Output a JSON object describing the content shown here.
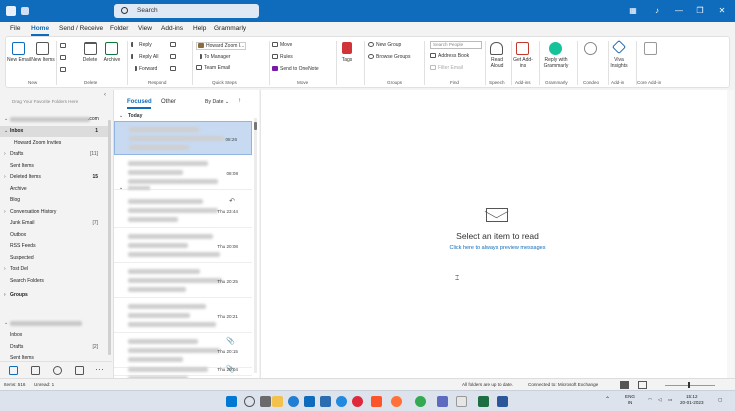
{
  "titlebar": {
    "search_placeholder": "Search"
  },
  "menu": {
    "tabs": [
      "File",
      "Home",
      "Send / Receive",
      "Folder",
      "View",
      "Add-ins",
      "Help",
      "Grammarly"
    ],
    "active": "Home"
  },
  "ribbon": {
    "new_email": "New Email",
    "new_items": "New Items",
    "delete": "Delete",
    "archive": "Archive",
    "reply": "Reply",
    "reply_all": "Reply All",
    "forward": "Forward",
    "quick_step_1": "Howard Zoom I...",
    "quick_step_2": "To Manager",
    "quick_step_3": "Team Email",
    "move": "Move",
    "rules": "Rules",
    "send_onenote": "Send to OneNote",
    "tags": "Tags",
    "new_group": "New Group",
    "browse_groups": "Browse Groups",
    "search_people": "Search People",
    "address_book": "Address Book",
    "filter_email": "Filter Email",
    "read_aloud": "Read Aloud",
    "get_addins": "Get Add-ins",
    "grammarly": "Reply with Grammarly",
    "viva_insights": "Viva Insights",
    "groups": {
      "new": "New",
      "delete": "Delete",
      "respond": "Respond",
      "quick_steps": "Quick Steps",
      "move": "Move",
      "groups": "Groups",
      "find": "Find",
      "speech": "Speech",
      "addins": "Add-ins",
      "grammarly": "Grammarly",
      "condeo": "Condeo",
      "addin": "Add-in",
      "core_addin": "Core Add-in"
    }
  },
  "folders": {
    "drag_hint": "Drag Your Favorite Folders Here",
    "account_suffix": ".com",
    "items": [
      {
        "name": "Inbox",
        "count": "1",
        "selected": true,
        "caret": "⌄"
      },
      {
        "name": "Howard Zoom Invites",
        "count": "",
        "indent": true
      },
      {
        "name": "Drafts",
        "count": "[11]",
        "caret": "›"
      },
      {
        "name": "Sent Items",
        "count": ""
      },
      {
        "name": "Deleted Items",
        "count": "15",
        "caret": "›",
        "bold_count": true
      },
      {
        "name": "Archive",
        "count": ""
      },
      {
        "name": "Blog",
        "count": ""
      },
      {
        "name": "Conversation History",
        "count": "",
        "caret": "›"
      },
      {
        "name": "Junk Email",
        "count": "[7]"
      },
      {
        "name": "Outbox",
        "count": ""
      },
      {
        "name": "RSS Feeds",
        "count": ""
      },
      {
        "name": "Suspected",
        "count": ""
      },
      {
        "name": "Tost Del",
        "count": "",
        "caret": "›"
      },
      {
        "name": "Search Folders",
        "count": ""
      }
    ],
    "groups_label": "Groups",
    "account2_items": [
      {
        "name": "Inbox",
        "count": ""
      },
      {
        "name": "Drafts",
        "count": "[2]"
      },
      {
        "name": "Sent Items",
        "count": ""
      }
    ]
  },
  "message_list": {
    "tab_focused": "Focused",
    "tab_other": "Other",
    "sort": "By Date",
    "group_today": "Today",
    "messages": [
      {
        "time": "08:26",
        "selected": true,
        "icon": ""
      },
      {
        "time": "08:08",
        "icon": ""
      },
      {
        "time": "Thu 23:44",
        "icon": "↶"
      },
      {
        "time": "Thu 20:08",
        "icon": ""
      },
      {
        "time": "Thu 20:25",
        "icon": ""
      },
      {
        "time": "Thu 20:21",
        "icon": ""
      },
      {
        "time": "Thu 20:15",
        "icon": "📎"
      },
      {
        "time": "Thu 20:04",
        "icon": "📎"
      }
    ]
  },
  "reading_pane": {
    "title": "Select an item to read",
    "link": "Click here to always preview messages"
  },
  "status": {
    "items": "Items: 516",
    "unread": "Unread: 1",
    "folders_uptodate": "All folders are up to date.",
    "connected": "Connected to: Microsoft Exchange"
  },
  "taskbar": {
    "lang": "ENG",
    "lang2": "IN",
    "time": "15:12",
    "date": "20-01-2023"
  }
}
